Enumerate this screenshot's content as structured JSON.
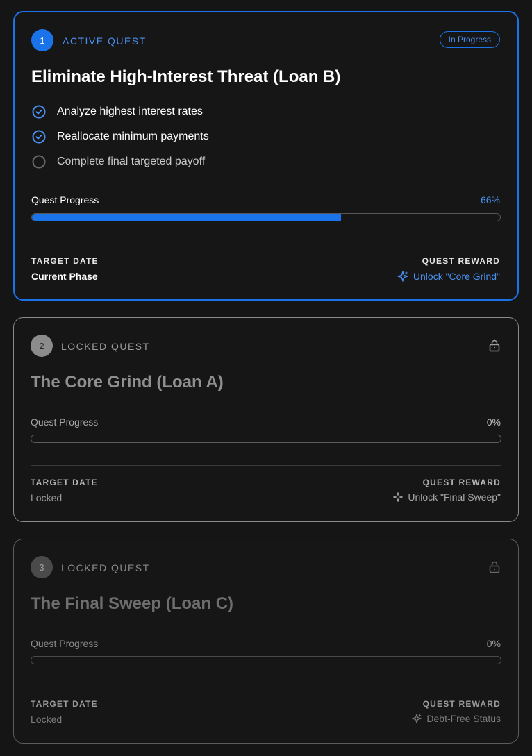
{
  "colors": {
    "accent": "#1a73e8",
    "background": "#151515"
  },
  "quests": [
    {
      "number": "1",
      "kicker": "ACTIVE QUEST",
      "status": "In Progress",
      "title": "Eliminate High-Interest Threat (Loan B)",
      "tasks": [
        {
          "label": "Analyze highest interest rates",
          "done": true
        },
        {
          "label": "Reallocate minimum payments",
          "done": true
        },
        {
          "label": "Complete final targeted payoff",
          "done": false
        }
      ],
      "progress_label": "Quest Progress",
      "progress_value": 0.66,
      "progress_pct": "66%",
      "target_date_label": "TARGET DATE",
      "target_date_value": "Current Phase",
      "reward_label": "QUEST REWARD",
      "reward_value": "Unlock \"Core Grind\"",
      "reward_icon": "sparkle-icon"
    },
    {
      "number": "2",
      "kicker": "LOCKED QUEST",
      "title": "The Core Grind (Loan A)",
      "lock_icon": "lock-icon",
      "progress_label": "Quest Progress",
      "progress_value": 0,
      "progress_pct": "0%",
      "target_date_label": "TARGET DATE",
      "target_date_value": "Locked",
      "reward_label": "QUEST REWARD",
      "reward_value": "Unlock \"Final Sweep\"",
      "reward_icon": "sparkle-icon"
    },
    {
      "number": "3",
      "kicker": "LOCKED QUEST",
      "title": "The Final Sweep (Loan C)",
      "lock_icon": "lock-icon",
      "progress_label": "Quest Progress",
      "progress_value": 0,
      "progress_pct": "0%",
      "target_date_label": "TARGET DATE",
      "target_date_value": "Locked",
      "reward_label": "QUEST REWARD",
      "reward_value": "Debt-Free Status",
      "reward_icon": "sparkle-icon"
    }
  ]
}
